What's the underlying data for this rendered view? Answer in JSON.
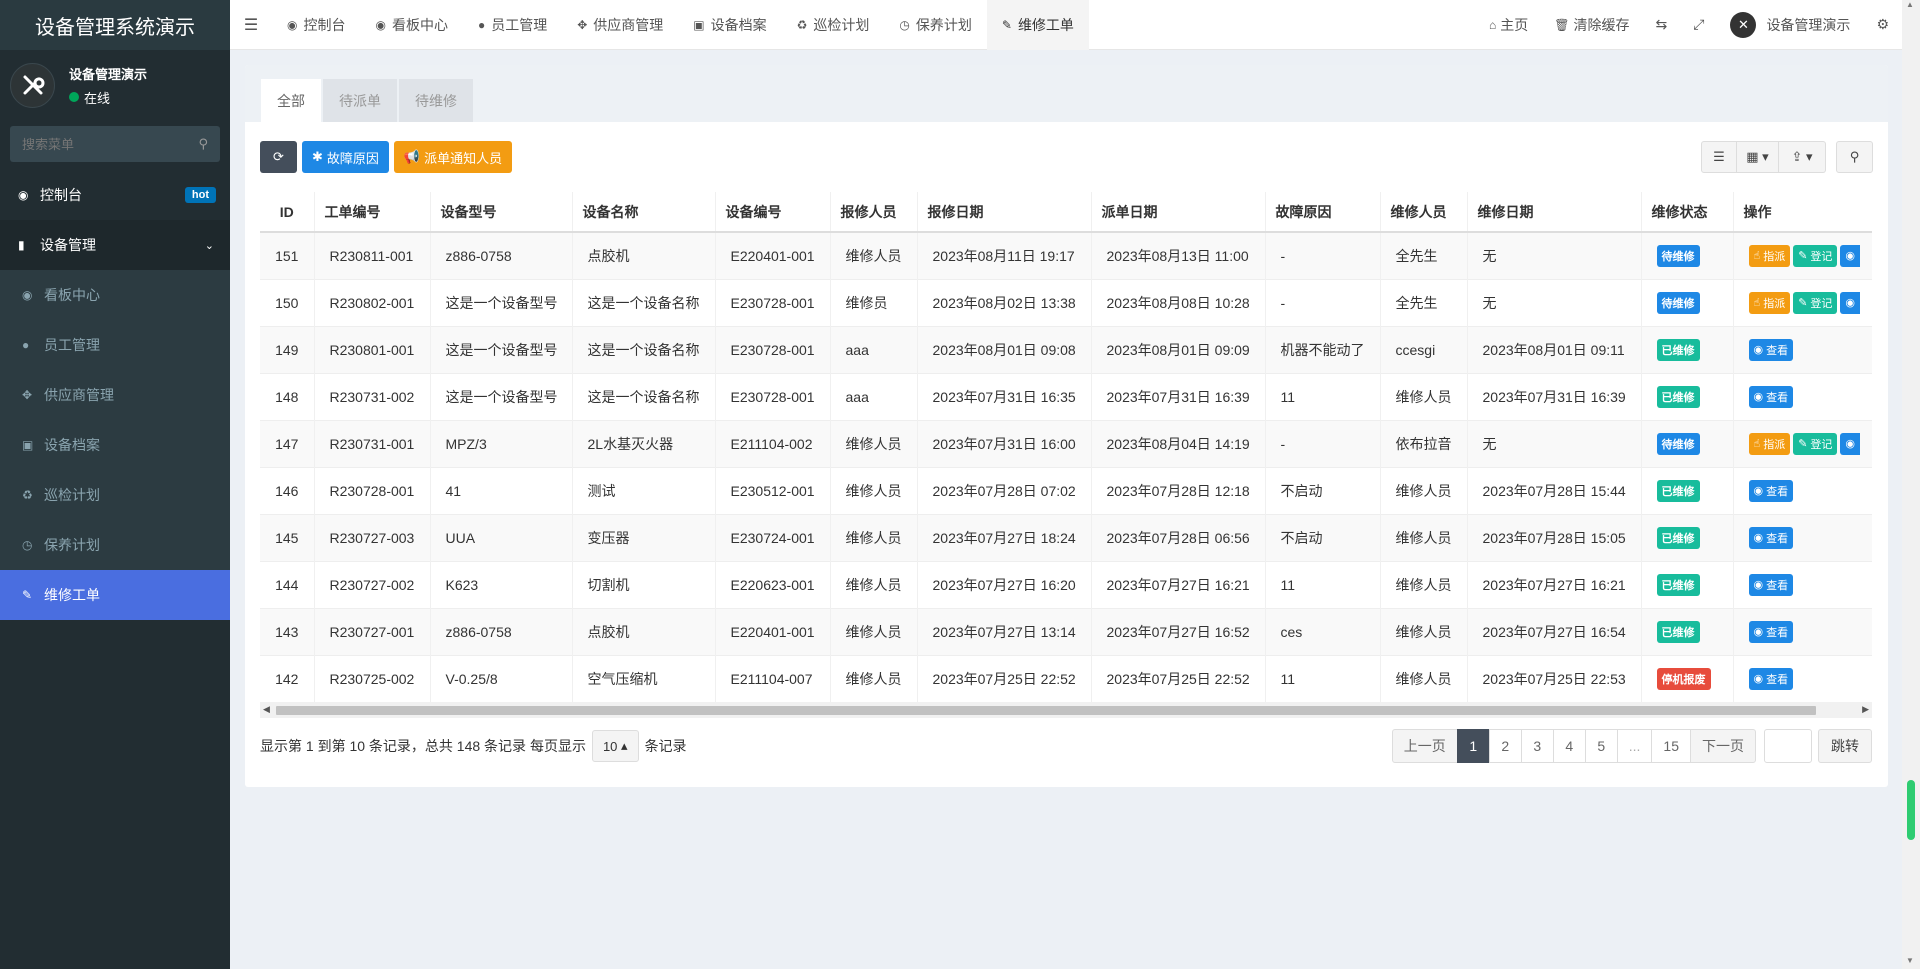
{
  "app": {
    "title": "设备管理系统演示"
  },
  "user": {
    "name": "设备管理演示",
    "status": "在线"
  },
  "sidebar": {
    "search_placeholder": "搜索菜单",
    "dashboard": "控制台",
    "hot": "hot",
    "group": "设备管理",
    "items": [
      "看板中心",
      "员工管理",
      "供应商管理",
      "设备档案",
      "巡检计划",
      "保养计划",
      "维修工单"
    ]
  },
  "topnav": {
    "tabs": [
      "控制台",
      "看板中心",
      "员工管理",
      "供应商管理",
      "设备档案",
      "巡检计划",
      "保养计划",
      "维修工单"
    ],
    "home": "主页",
    "clear_cache": "清除缓存",
    "user": "设备管理演示"
  },
  "subtabs": [
    "全部",
    "待派单",
    "待维修"
  ],
  "toolbar": {
    "fault_reason": "故障原因",
    "notify": "派单通知人员"
  },
  "table": {
    "headers": [
      "ID",
      "工单编号",
      "设备型号",
      "设备名称",
      "设备编号",
      "报修人员",
      "报修日期",
      "派单日期",
      "故障原因",
      "维修人员",
      "维修日期",
      "维修状态",
      "操作"
    ],
    "actions": {
      "assign": "指派",
      "register": "登记",
      "view": "查看"
    },
    "rows": [
      {
        "id": "151",
        "no": "R230811-001",
        "model": "z886-0758",
        "name": "点胶机",
        "code": "E220401-001",
        "reporter": "维修人员",
        "rdate": "2023年08月11日 19:17",
        "ddate": "2023年08月13日 11:00",
        "reason": "-",
        "repairer": "全先生",
        "fdate": "无",
        "status": "待维修",
        "stype": "wait"
      },
      {
        "id": "150",
        "no": "R230802-001",
        "model": "这是一个设备型号",
        "name": "这是一个设备名称",
        "code": "E230728-001",
        "reporter": "维修员",
        "rdate": "2023年08月02日 13:38",
        "ddate": "2023年08月08日 10:28",
        "reason": "-",
        "repairer": "全先生",
        "fdate": "无",
        "status": "待维修",
        "stype": "wait"
      },
      {
        "id": "149",
        "no": "R230801-001",
        "model": "这是一个设备型号",
        "name": "这是一个设备名称",
        "code": "E230728-001",
        "reporter": "aaa",
        "rdate": "2023年08月01日 09:08",
        "ddate": "2023年08月01日 09:09",
        "reason": "机器不能动了",
        "repairer": "ccesgi",
        "fdate": "2023年08月01日 09:11",
        "status": "已维修",
        "stype": "done"
      },
      {
        "id": "148",
        "no": "R230731-002",
        "model": "这是一个设备型号",
        "name": "这是一个设备名称",
        "code": "E230728-001",
        "reporter": "aaa",
        "rdate": "2023年07月31日 16:35",
        "ddate": "2023年07月31日 16:39",
        "reason": "11",
        "repairer": "维修人员",
        "fdate": "2023年07月31日 16:39",
        "status": "已维修",
        "stype": "done"
      },
      {
        "id": "147",
        "no": "R230731-001",
        "model": "MPZ/3",
        "name": "2L水基灭火器",
        "code": "E211104-002",
        "reporter": "维修人员",
        "rdate": "2023年07月31日 16:00",
        "ddate": "2023年08月04日 14:19",
        "reason": "-",
        "repairer": "依布拉音",
        "fdate": "无",
        "status": "待维修",
        "stype": "wait"
      },
      {
        "id": "146",
        "no": "R230728-001",
        "model": "41",
        "name": "测试",
        "code": "E230512-001",
        "reporter": "维修人员",
        "rdate": "2023年07月28日 07:02",
        "ddate": "2023年07月28日 12:18",
        "reason": "不启动",
        "repairer": "维修人员",
        "fdate": "2023年07月28日 15:44",
        "status": "已维修",
        "stype": "done"
      },
      {
        "id": "145",
        "no": "R230727-003",
        "model": "UUA",
        "name": "变压器",
        "code": "E230724-001",
        "reporter": "维修人员",
        "rdate": "2023年07月27日 18:24",
        "ddate": "2023年07月28日 06:56",
        "reason": "不启动",
        "repairer": "维修人员",
        "fdate": "2023年07月28日 15:05",
        "status": "已维修",
        "stype": "done"
      },
      {
        "id": "144",
        "no": "R230727-002",
        "model": "K623",
        "name": "切割机",
        "code": "E220623-001",
        "reporter": "维修人员",
        "rdate": "2023年07月27日 16:20",
        "ddate": "2023年07月27日 16:21",
        "reason": "11",
        "repairer": "维修人员",
        "fdate": "2023年07月27日 16:21",
        "status": "已维修",
        "stype": "done"
      },
      {
        "id": "143",
        "no": "R230727-001",
        "model": "z886-0758",
        "name": "点胶机",
        "code": "E220401-001",
        "reporter": "维修人员",
        "rdate": "2023年07月27日 13:14",
        "ddate": "2023年07月27日 16:52",
        "reason": "ces",
        "repairer": "维修人员",
        "fdate": "2023年07月27日 16:54",
        "status": "已维修",
        "stype": "done"
      },
      {
        "id": "142",
        "no": "R230725-002",
        "model": "V-0.25/8",
        "name": "空气压缩机",
        "code": "E211104-007",
        "reporter": "维修人员",
        "rdate": "2023年07月25日 22:52",
        "ddate": "2023年07月25日 22:52",
        "reason": "11",
        "repairer": "维修人员",
        "fdate": "2023年07月25日 22:53",
        "status": "停机报废",
        "stype": "stop"
      }
    ]
  },
  "pagination": {
    "info_prefix": "显示第 1 到第 10 条记录，总共 148 条记录 每页显示",
    "page_size": "10",
    "info_suffix": "条记录",
    "prev": "上一页",
    "pages": [
      "1",
      "2",
      "3",
      "4",
      "5",
      "...",
      "15"
    ],
    "next": "下一页",
    "jump": "跳转"
  }
}
